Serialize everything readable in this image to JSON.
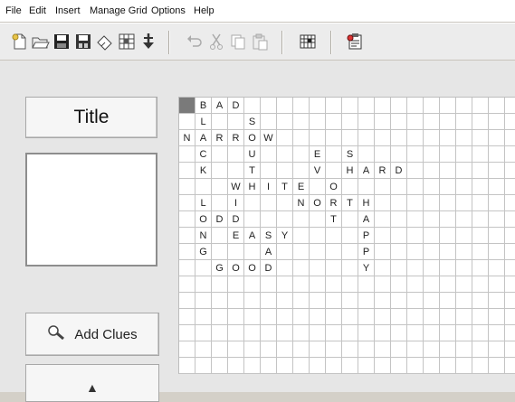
{
  "menu": [
    "File",
    "Edit",
    "Insert",
    "Manage Grid",
    "Options",
    "Help"
  ],
  "toolbar": {
    "icons": [
      "new-file-icon",
      "open-folder-icon",
      "save-icon",
      "save-as-icon",
      "eraser-icon",
      "grid-pattern-icon",
      "insert-down-arrow-icon",
      "undo-icon",
      "cut-icon",
      "copy-icon",
      "paste-icon",
      "grid-settings-icon",
      "clipboard-icon"
    ]
  },
  "sidebar": {
    "title_label": "Title",
    "add_clues_label": "Add Clues",
    "up_label": "▲"
  },
  "grid": {
    "selected": [
      0,
      0
    ],
    "rows": [
      [
        "",
        "B",
        "A",
        "D",
        "",
        "",
        "",
        "",
        "",
        "",
        "",
        "",
        "",
        "",
        "",
        "",
        "",
        "",
        "",
        "",
        ""
      ],
      [
        "",
        "L",
        "",
        "",
        "S",
        "",
        "",
        "",
        "",
        "",
        "",
        "",
        "",
        "",
        "",
        "",
        "",
        "",
        "",
        "",
        ""
      ],
      [
        "N",
        "A",
        "R",
        "R",
        "O",
        "W",
        "",
        "",
        "",
        "",
        "",
        "",
        "",
        "",
        "",
        "",
        "",
        "",
        "",
        "",
        ""
      ],
      [
        "",
        "C",
        "",
        "",
        "U",
        "",
        "",
        "",
        "E",
        "",
        "S",
        "",
        "",
        "",
        "",
        "",
        "",
        "",
        "",
        "",
        ""
      ],
      [
        "",
        "K",
        "",
        "",
        "T",
        "",
        "",
        "",
        "V",
        "",
        "H",
        "A",
        "R",
        "D",
        "",
        "",
        "",
        "",
        "",
        "",
        ""
      ],
      [
        "",
        "",
        "",
        "W",
        "H",
        "I",
        "T",
        "E",
        "",
        "O",
        "",
        "",
        "",
        "",
        "",
        "",
        "",
        "",
        "",
        "",
        ""
      ],
      [
        "",
        "L",
        "",
        "I",
        "",
        "",
        "",
        "N",
        "O",
        "R",
        "T",
        "H",
        "",
        "",
        "",
        "",
        "",
        "",
        "",
        "",
        ""
      ],
      [
        "",
        "O",
        "D",
        "D",
        "",
        "",
        "",
        "",
        "",
        "T",
        "",
        "A",
        "",
        "",
        "",
        "",
        "",
        "",
        "",
        "",
        ""
      ],
      [
        "",
        "N",
        "",
        "E",
        "A",
        "S",
        "Y",
        "",
        "",
        "",
        "",
        "P",
        "",
        "",
        "",
        "",
        "",
        "",
        "",
        "",
        ""
      ],
      [
        "",
        "G",
        "",
        "",
        "",
        "A",
        "",
        "",
        "",
        "",
        "",
        "P",
        "",
        "",
        "",
        "",
        "",
        "",
        "",
        "",
        ""
      ],
      [
        "",
        "",
        "G",
        "O",
        "O",
        "D",
        "",
        "",
        "",
        "",
        "",
        "Y",
        "",
        "",
        "",
        "",
        "",
        "",
        "",
        "",
        ""
      ],
      [
        "",
        "",
        "",
        "",
        "",
        "",
        "",
        "",
        "",
        "",
        "",
        "",
        "",
        "",
        "",
        "",
        "",
        "",
        "",
        "",
        ""
      ],
      [
        "",
        "",
        "",
        "",
        "",
        "",
        "",
        "",
        "",
        "",
        "",
        "",
        "",
        "",
        "",
        "",
        "",
        "",
        "",
        "",
        ""
      ],
      [
        "",
        "",
        "",
        "",
        "",
        "",
        "",
        "",
        "",
        "",
        "",
        "",
        "",
        "",
        "",
        "",
        "",
        "",
        "",
        "",
        ""
      ],
      [
        "",
        "",
        "",
        "",
        "",
        "",
        "",
        "",
        "",
        "",
        "",
        "",
        "",
        "",
        "",
        "",
        "",
        "",
        "",
        "",
        ""
      ],
      [
        "",
        "",
        "",
        "",
        "",
        "",
        "",
        "",
        "",
        "",
        "",
        "",
        "",
        "",
        "",
        "",
        "",
        "",
        "",
        "",
        ""
      ],
      [
        "",
        "",
        "",
        "",
        "",
        "",
        "",
        "",
        "",
        "",
        "",
        "",
        "",
        "",
        "",
        "",
        "",
        "",
        "",
        "",
        ""
      ]
    ]
  }
}
